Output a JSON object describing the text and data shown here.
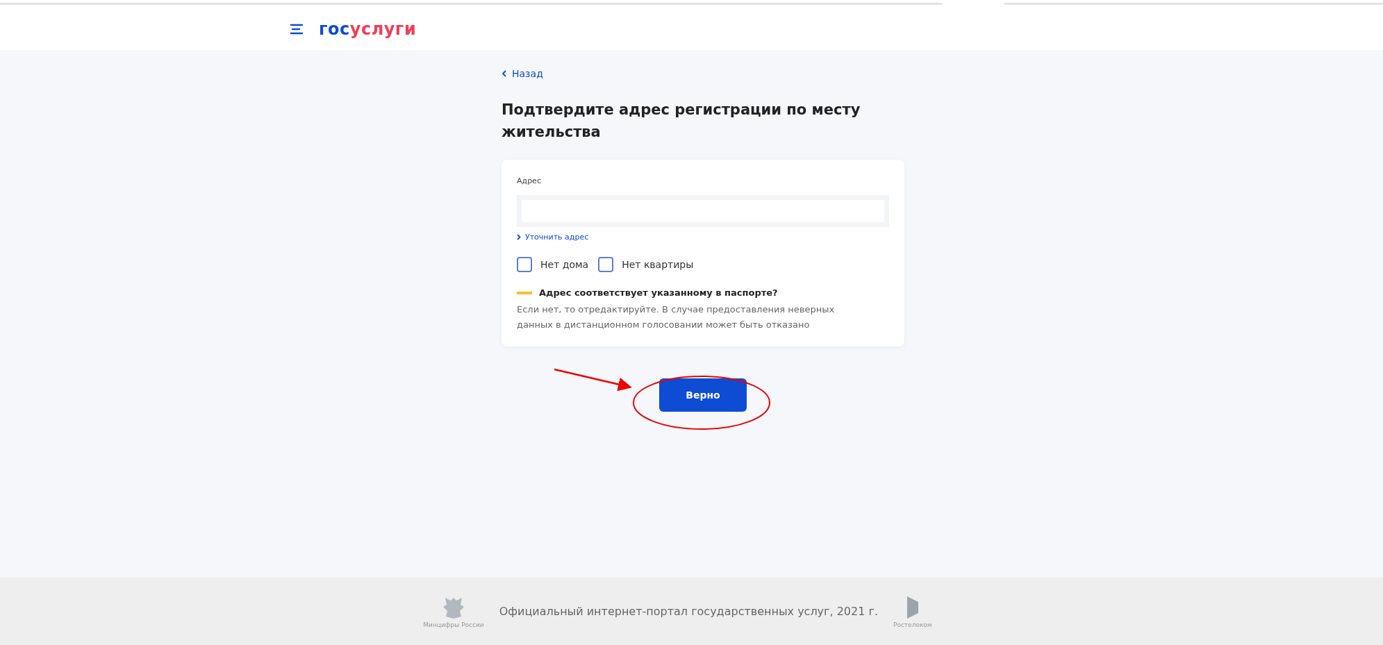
{
  "header": {
    "logo": [
      {
        "text": "гос",
        "color": "#0d4cd3"
      },
      {
        "text": "услуги",
        "color": "#ee3f58"
      }
    ]
  },
  "back_link": {
    "label": "Назад"
  },
  "title": "Подтвердите адрес регистрации по месту жительства",
  "form": {
    "address_label": "Адрес",
    "clarify_link": "Уточнить адрес",
    "checkboxes": [
      {
        "label": "Нет дома",
        "checked": false
      },
      {
        "label": "Нет квартиры",
        "checked": false
      }
    ],
    "notice_title": "Адрес соответствует указанному в паспорте?",
    "notice_text": "Если нет, то отредактируйте. В случае предоставления неверных данных в дистанционном голосовании может быть отказано"
  },
  "confirm_button": "Верно",
  "footer": {
    "left_caption": "Минцифры России",
    "text": "Официальный интернет-портал государственных услуг, 2021 г.",
    "right_caption": "Ростелеком"
  }
}
